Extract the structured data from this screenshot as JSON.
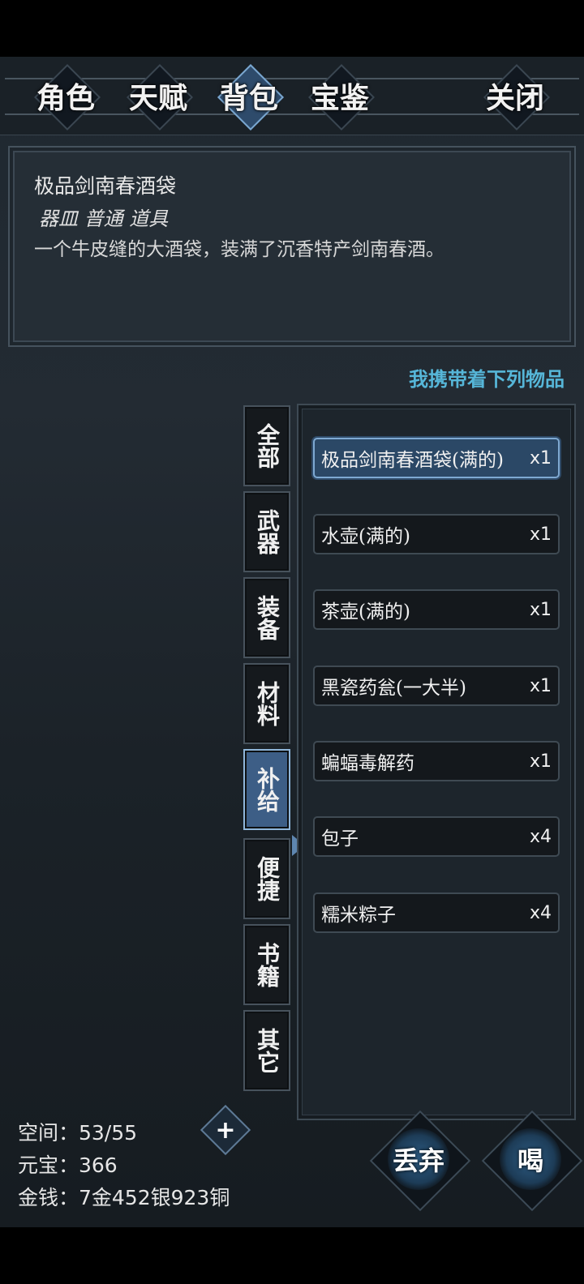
{
  "tabs": [
    {
      "label": "角色"
    },
    {
      "label": "天赋"
    },
    {
      "label": "背包"
    },
    {
      "label": "宝鉴"
    },
    {
      "label": "关闭"
    }
  ],
  "selected_item": {
    "title": "极品剑南春酒袋",
    "type": "器皿 普通 道具",
    "description": "一个牛皮缝的大酒袋，装满了沉香特产剑南春酒。"
  },
  "carry_label": "我携带着下列物品",
  "categories": [
    {
      "label": "全部"
    },
    {
      "label": "武器"
    },
    {
      "label": "装备"
    },
    {
      "label": "材料"
    },
    {
      "label": "补给"
    },
    {
      "label": "便捷"
    },
    {
      "label": "书籍"
    },
    {
      "label": "其它"
    }
  ],
  "items": [
    {
      "name": "极品剑南春酒袋(满的)",
      "qty": "x1"
    },
    {
      "name": "水壶(满的)",
      "qty": "x1"
    },
    {
      "name": "茶壶(满的)",
      "qty": "x1"
    },
    {
      "name": "黑瓷药瓮(一大半)",
      "qty": "x1"
    },
    {
      "name": "蝙蝠毒解药",
      "qty": "x1"
    },
    {
      "name": "包子",
      "qty": "x4"
    },
    {
      "name": "糯米粽子",
      "qty": "x4"
    }
  ],
  "stats": {
    "space": "空间：53/55",
    "yuanbao": "元宝：366",
    "money": "金钱：7金452银923铜"
  },
  "add_label": "+",
  "actions": {
    "discard": "丢弃",
    "drink": "喝"
  },
  "colors": {
    "accent": "#56b6d8",
    "active_blue": "#3d5e86",
    "background": "#1f2830"
  }
}
